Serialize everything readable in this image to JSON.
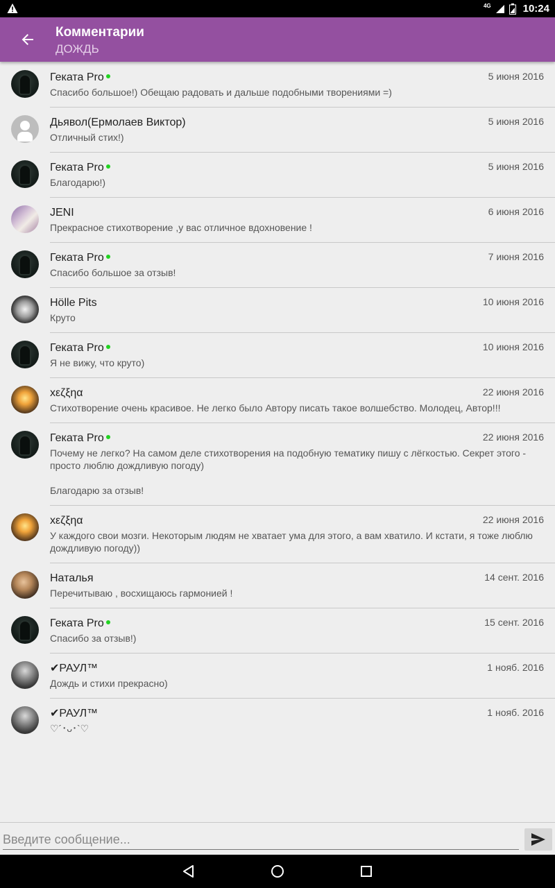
{
  "status_bar": {
    "network": "4G",
    "time": "10:24"
  },
  "header": {
    "title": "Комментарии",
    "subtitle": "ДОЖДЬ"
  },
  "comments": [
    {
      "author": "Геката Pro",
      "online": true,
      "date": "5 июня 2016",
      "text": "Спасибо большое!) Обещаю радовать и дальше подобными творениями =)",
      "avatar": "dark-figure"
    },
    {
      "author": "Дьявол(Ермолаев Виктор)",
      "online": false,
      "date": "5 июня 2016",
      "text": "Отличный стих!)",
      "avatar": "default-user"
    },
    {
      "author": "Геката Pro",
      "online": true,
      "date": "5 июня 2016",
      "text": "Благодарю!)",
      "avatar": "dark-figure"
    },
    {
      "author": "JENI",
      "online": false,
      "date": "6 июня 2016",
      "text": "Прекрасное стихотворение ,у вас отличное вдохновение !",
      "avatar": "jeni"
    },
    {
      "author": "Геката Pro",
      "online": true,
      "date": "7 июня 2016",
      "text": "Спасибо большое за отзыв!",
      "avatar": "dark-figure"
    },
    {
      "author": "Hölle Pits",
      "online": false,
      "date": "10 июня 2016",
      "text": "Круто",
      "avatar": "holle"
    },
    {
      "author": "Геката Pro",
      "online": true,
      "date": "10 июня 2016",
      "text": "Я не вижу, что круто)",
      "avatar": "dark-figure"
    },
    {
      "author": "xεζξηα",
      "online": false,
      "date": "22 июня 2016",
      "text": "Стихотворение очень красивое. Не легко было Автору писать такое волшебство. Молодец, Автор!!!",
      "avatar": "sunset"
    },
    {
      "author": "Геката Pro",
      "online": true,
      "date": "22 июня 2016",
      "text": "Почему не легко? На самом деле стихотворения на подобную тематику пишу с лёгкостью. Секрет этого - просто люблю дождливую погоду)\n\nБлагодарю за отзыв!",
      "avatar": "dark-figure"
    },
    {
      "author": "xεζξηα",
      "online": false,
      "date": "22 июня 2016",
      "text": "У каждого свои мозги. Некоторым людям не хватает ума для этого, а вам хватило. И кстати, я тоже люблю дождливую погоду))",
      "avatar": "sunset"
    },
    {
      "author": "Наталья",
      "online": false,
      "date": "14 сент. 2016",
      "text": "Перечитываю , восхищаюсь гармонией !",
      "avatar": "natalia"
    },
    {
      "author": "Геката Pro",
      "online": true,
      "date": "15 сент. 2016",
      "text": "Спасибо за отзыв!)",
      "avatar": "dark-figure"
    },
    {
      "author": "✔РАУЛ™",
      "online": false,
      "date": "1 нояб. 2016",
      "text": "Дождь и стихи прекрасно)",
      "avatar": "raul"
    },
    {
      "author": "✔РАУЛ™",
      "online": false,
      "date": "1 нояб. 2016",
      "text": "♡´･ᴗ･`♡",
      "avatar": "raul"
    }
  ],
  "composer": {
    "placeholder": "Введите сообщение..."
  },
  "colors": {
    "app_bar": "#9450a0",
    "online": "#22d322",
    "background": "#eeeeee"
  },
  "icons": {
    "back": "arrow-back-icon",
    "send": "send-icon",
    "nav_back": "triangle-back-icon",
    "nav_home": "circle-home-icon",
    "nav_recents": "square-recents-icon"
  }
}
